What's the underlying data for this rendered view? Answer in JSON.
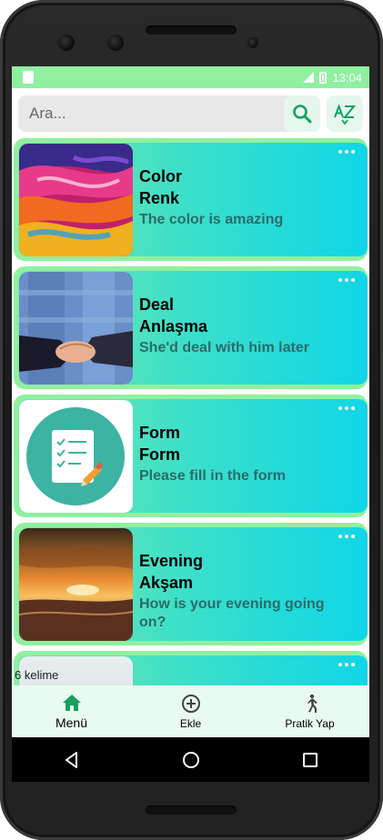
{
  "status_bar": {
    "time": "13:04"
  },
  "search": {
    "placeholder": "Ara..."
  },
  "cards": [
    {
      "word": "Color",
      "translation": "Renk",
      "sentence": "The color is amazing"
    },
    {
      "word": "Deal",
      "translation": "Anlaşma",
      "sentence": "She'd deal with him later"
    },
    {
      "word": "Form",
      "translation": "Form",
      "sentence": "Please fill in the form"
    },
    {
      "word": "Evening",
      "translation": "Akşam",
      "sentence": "How is your evening going on?"
    }
  ],
  "word_count": "6  kelime",
  "nav": {
    "home_label": "Menü",
    "add_label": "Ekle",
    "practice_label": "Pratik Yap"
  },
  "colors": {
    "accent_green": "#90f0a0",
    "icon_green": "#16a060",
    "card_gradient_end": "#10d6e6"
  }
}
